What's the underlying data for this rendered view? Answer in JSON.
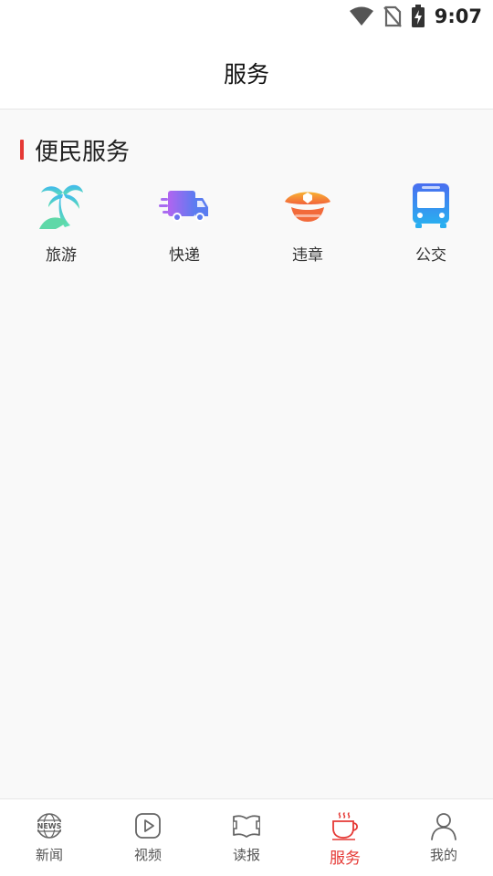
{
  "status_bar": {
    "time": "9:07",
    "icons": [
      "wifi-icon",
      "no-sim-icon",
      "battery-charging-icon"
    ]
  },
  "header": {
    "title": "服务"
  },
  "section": {
    "title": "便民服务",
    "accent_color": "#e53935"
  },
  "services": [
    {
      "label": "旅游",
      "icon": "palm-tree-icon"
    },
    {
      "label": "快递",
      "icon": "delivery-truck-icon"
    },
    {
      "label": "违章",
      "icon": "police-cap-icon"
    },
    {
      "label": "公交",
      "icon": "bus-icon"
    }
  ],
  "tabbar": {
    "active_color": "#e53935",
    "tabs": [
      {
        "label": "新闻",
        "icon": "news-globe-icon",
        "active": false
      },
      {
        "label": "视频",
        "icon": "video-play-icon",
        "active": false
      },
      {
        "label": "读报",
        "icon": "newspaper-icon",
        "active": false
      },
      {
        "label": "服务",
        "icon": "coffee-cup-icon",
        "active": true
      },
      {
        "label": "我的",
        "icon": "user-icon",
        "active": false
      }
    ]
  }
}
